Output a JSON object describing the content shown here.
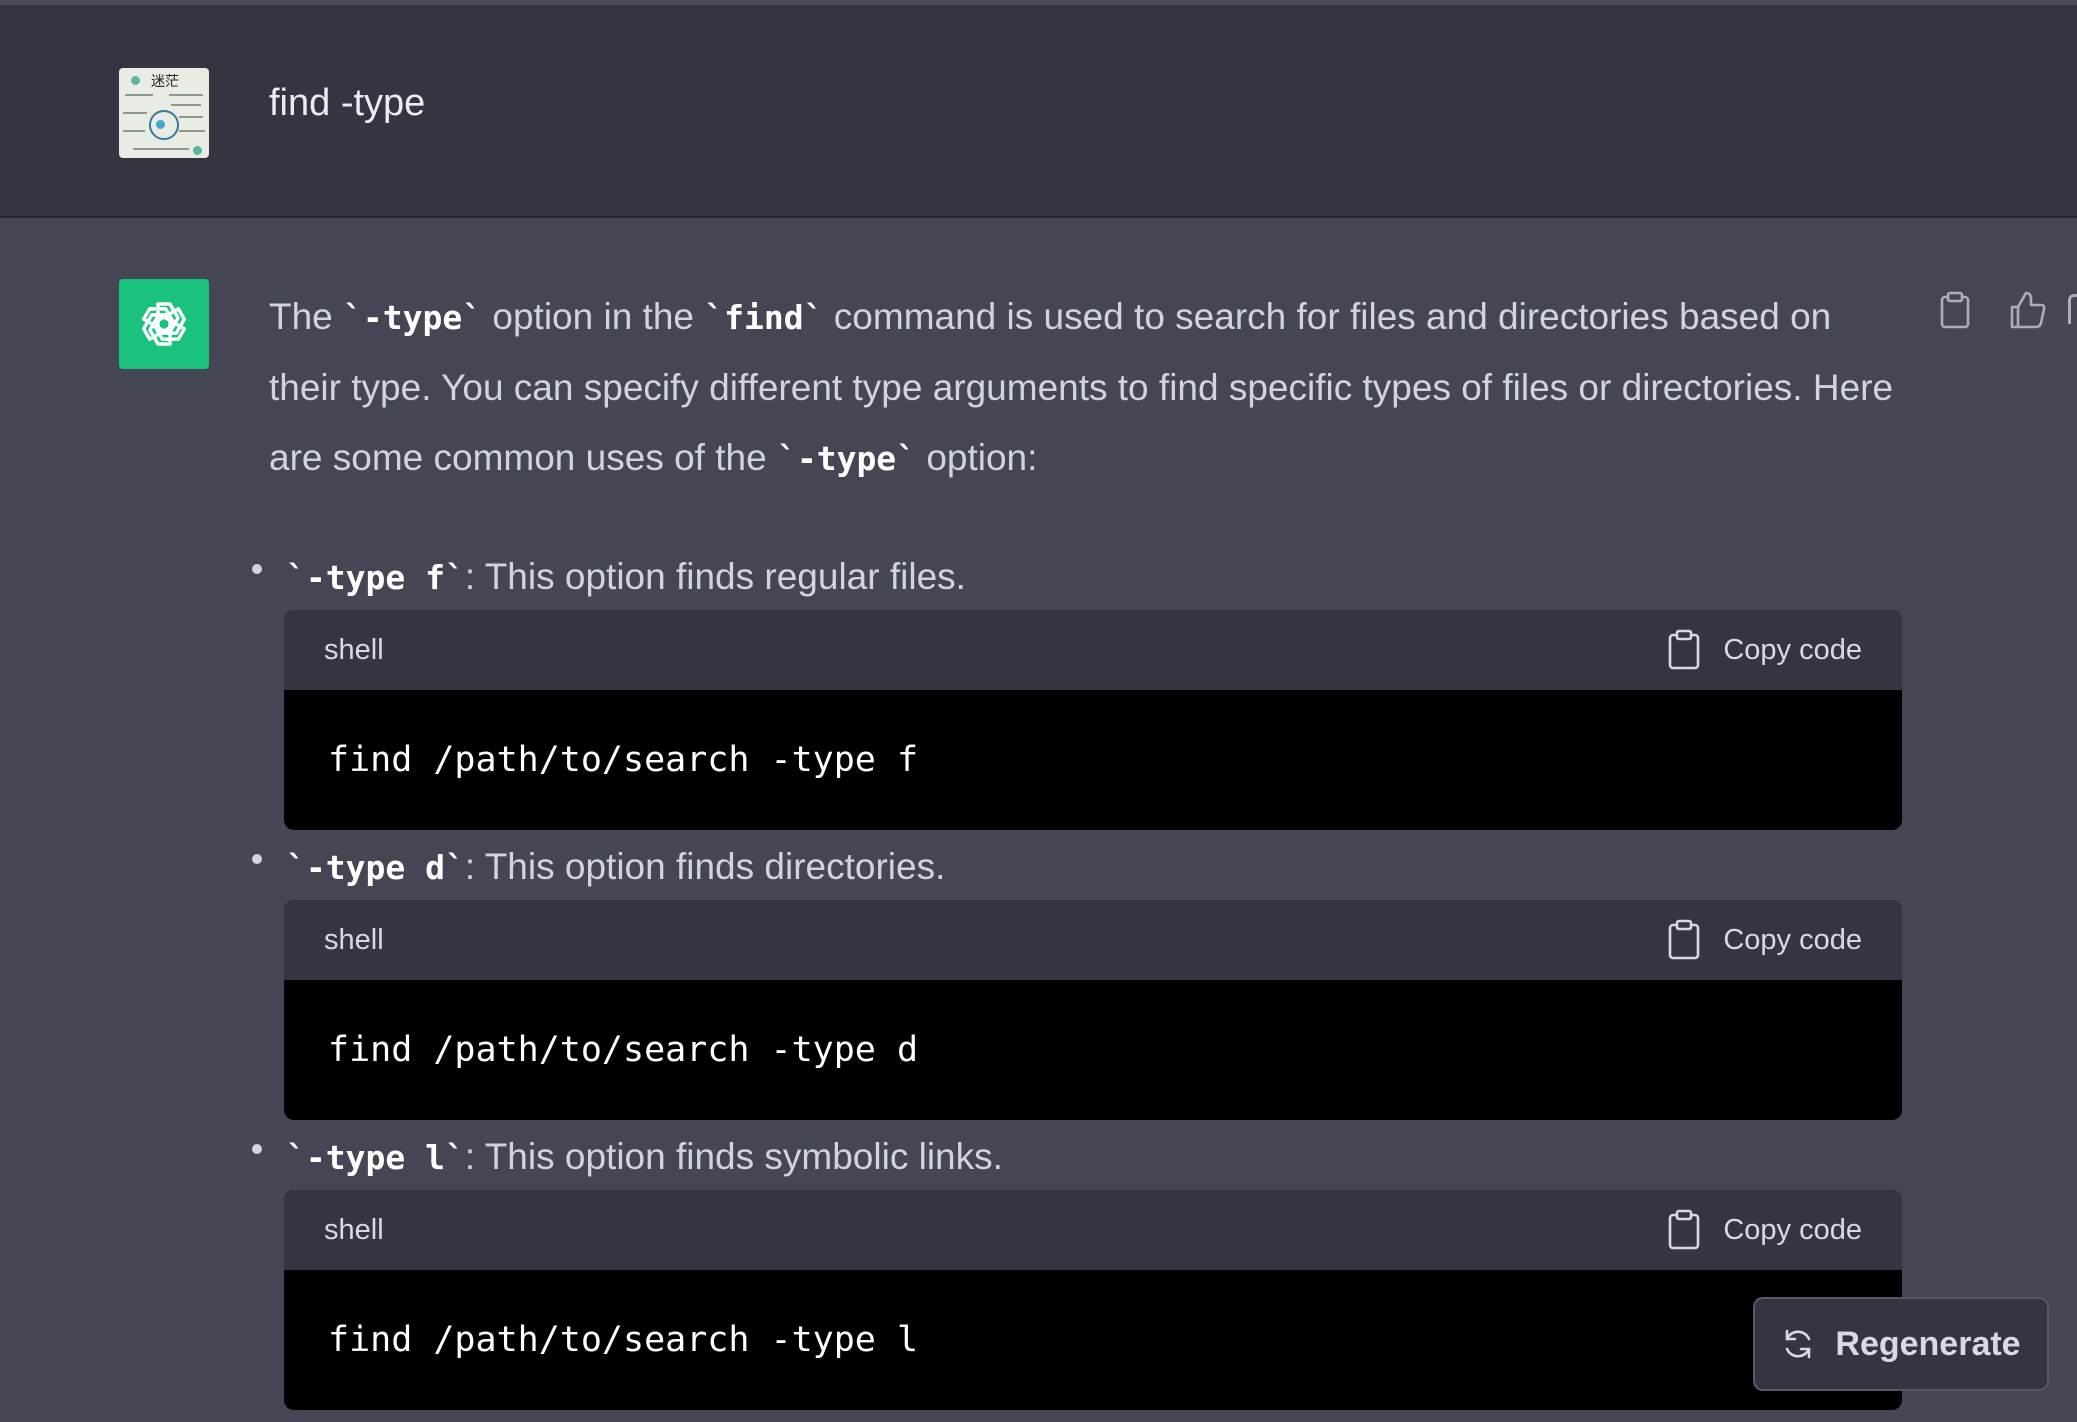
{
  "user_message": {
    "text": "find -type"
  },
  "assistant": {
    "intro": {
      "p1": "The ",
      "c1": "`-type`",
      "p2": " option in the ",
      "c2": "`find`",
      "p3": " command is used to search for files and directories based on their type. You can specify different type arguments to find specific types of files or directories. Here are some common uses of the ",
      "c3": "`-type`",
      "p4": " option:"
    },
    "items": [
      {
        "code": "`-type f`",
        "text": ": This option finds regular files.",
        "lang": "shell",
        "copy_label": "Copy code",
        "command": "find /path/to/search -type f"
      },
      {
        "code": "`-type d`",
        "text": ": This option finds directories.",
        "lang": "shell",
        "copy_label": "Copy code",
        "command": "find /path/to/search -type d"
      },
      {
        "code": "`-type l`",
        "text": ": This option finds symbolic links.",
        "lang": "shell",
        "copy_label": "Copy code",
        "command": "find /path/to/search -type l"
      }
    ]
  },
  "regenerate_label": "Regenerate",
  "icons": {
    "assistant_logo": "openai-logo-icon",
    "copy": "clipboard-icon",
    "thumbs_up": "thumbs-up-icon",
    "regenerate": "refresh-icon"
  },
  "colors": {
    "assistant_logo_bg": "#19c37d",
    "user_row_bg": "#343541",
    "assistant_row_bg": "#444654",
    "code_bg": "#000000"
  }
}
